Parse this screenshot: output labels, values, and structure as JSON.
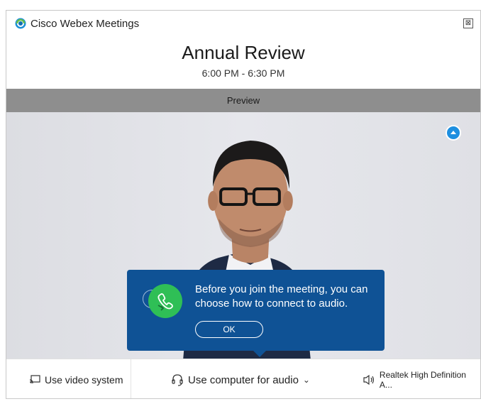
{
  "window": {
    "app_title": "Cisco Webex Meetings",
    "close_glyph": "⊠"
  },
  "meeting": {
    "title": "Annual Review",
    "time": "6:00 PM - 6:30 PM"
  },
  "preview": {
    "label": "Preview"
  },
  "toast": {
    "message": "Before you join the meeting, you can choose how to connect to audio.",
    "ok_label": "OK"
  },
  "footer": {
    "video_system_label": "Use video system",
    "audio_label": "Use computer for audio",
    "speaker_label": "Realtek High Definition A..."
  },
  "icons": {
    "app_logo": "webex-logo-icon",
    "close": "close-icon",
    "blur": "background-blur-icon",
    "phone": "phone-icon",
    "video_system": "cast-screen-icon",
    "headset": "headset-icon",
    "speaker": "speaker-icon",
    "chevron": "chevron-down-icon"
  },
  "colors": {
    "toast_bg": "#0f5295",
    "phone_green": "#2fbf56",
    "blur_blue": "#1d8fe0",
    "preview_bar": "#8e8e8e"
  }
}
